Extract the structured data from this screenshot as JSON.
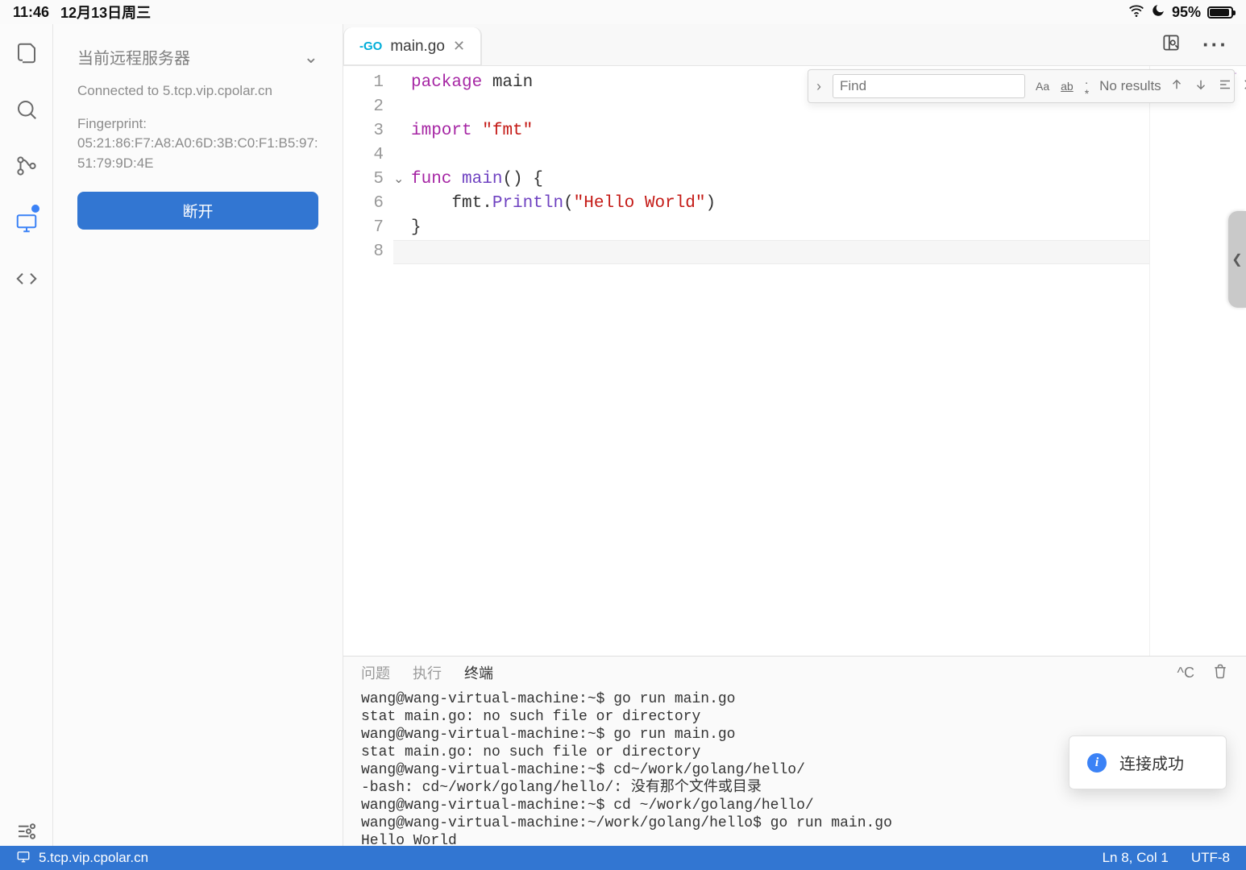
{
  "statusbar": {
    "time": "11:46",
    "date": "12月13日周三",
    "battery_pct": "95%"
  },
  "activitybar": {
    "items": [
      "explorer",
      "search",
      "source-control",
      "remote",
      "code"
    ],
    "active": "remote"
  },
  "sidebar": {
    "title": "当前远程服务器",
    "connected_label": "Connected to 5.tcp.vip.cpolar.cn",
    "fingerprint_label": "Fingerprint:",
    "fingerprint_value": "05:21:86:F7:A8:A0:6D:3B:C0:F1:B5:97:51:79:9D:4E",
    "disconnect_label": "断开"
  },
  "tabs": [
    {
      "icon": "go",
      "label": "main.go",
      "dirty": false
    }
  ],
  "find": {
    "placeholder": "Find",
    "value": "",
    "results": "No results"
  },
  "editor": {
    "filename": "main.go",
    "cursor_line": 8,
    "lines": [
      {
        "n": 1,
        "tokens": [
          [
            "kw",
            "package"
          ],
          [
            "sp",
            " "
          ],
          [
            "ident",
            "main"
          ]
        ]
      },
      {
        "n": 2,
        "tokens": []
      },
      {
        "n": 3,
        "tokens": [
          [
            "kw",
            "import"
          ],
          [
            "sp",
            " "
          ],
          [
            "str",
            "\"fmt\""
          ]
        ]
      },
      {
        "n": 4,
        "tokens": []
      },
      {
        "n": 5,
        "fold": true,
        "tokens": [
          [
            "kw",
            "func"
          ],
          [
            "sp",
            " "
          ],
          [
            "func",
            "main"
          ],
          [
            "ident",
            "()"
          ],
          [
            "sp",
            " "
          ],
          [
            "ident",
            "{"
          ]
        ]
      },
      {
        "n": 6,
        "tokens": [
          [
            "sp",
            "    "
          ],
          [
            "ident",
            "fmt"
          ],
          [
            "ident",
            "."
          ],
          [
            "call",
            "Println"
          ],
          [
            "ident",
            "("
          ],
          [
            "str",
            "\"Hello World\""
          ],
          [
            "ident",
            ")"
          ]
        ]
      },
      {
        "n": 7,
        "tokens": [
          [
            "ident",
            "}"
          ]
        ]
      },
      {
        "n": 8,
        "tokens": []
      }
    ]
  },
  "panel": {
    "tabs": [
      {
        "id": "problems",
        "label": "问题",
        "active": false
      },
      {
        "id": "run",
        "label": "执行",
        "active": false
      },
      {
        "id": "terminal",
        "label": "终端",
        "active": true
      }
    ],
    "kill_label": "^C",
    "terminal_lines": [
      "wang@wang-virtual-machine:~$ go run main.go",
      "stat main.go: no such file or directory",
      "wang@wang-virtual-machine:~$ go run main.go",
      "stat main.go: no such file or directory",
      "wang@wang-virtual-machine:~$ cd~/work/golang/hello/",
      "-bash: cd~/work/golang/hello/: 没有那个文件或目录",
      "wang@wang-virtual-machine:~$ cd ~/work/golang/hello/",
      "wang@wang-virtual-machine:~/work/golang/hello$ go run main.go",
      "Hello World"
    ]
  },
  "statusstrip": {
    "host": "5.tcp.vip.cpolar.cn",
    "cursor": "Ln 8, Col 1",
    "encoding": "UTF-8"
  },
  "toast": {
    "message": "连接成功"
  }
}
